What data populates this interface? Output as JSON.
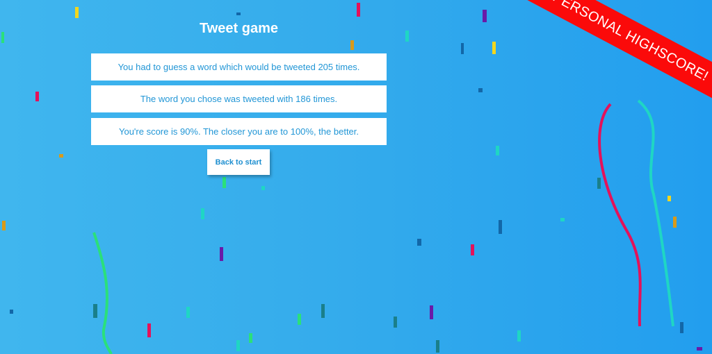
{
  "game": {
    "title": "Tweet game",
    "messages": [
      "You had to guess a word which would be tweeted 205 times.",
      "The word you chose was tweeted with 186 times.",
      "You're score is 90%. The closer you are to 100%, the better."
    ],
    "back_label": "Back to start",
    "banner_text": "PERSONAL HIGHSCORE!"
  },
  "colors": {
    "background": "#35acec",
    "banner": "#fb0a0a",
    "text_accent": "#2196d6"
  }
}
